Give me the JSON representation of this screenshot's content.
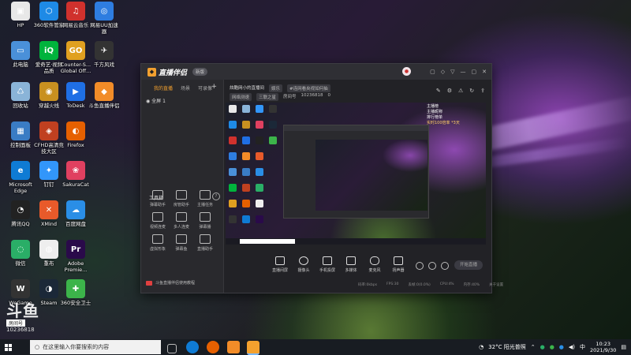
{
  "desktop": {
    "icons": [
      {
        "label": "HP",
        "color": "#e8e8e8",
        "glyph": "▣"
      },
      {
        "label": "360软件管家",
        "color": "#1e8ae6",
        "glyph": "⬡"
      },
      {
        "label": "网易云音乐",
        "color": "#d0312d",
        "glyph": "♫"
      },
      {
        "label": "网易UU加速器",
        "color": "#2e7de0",
        "glyph": "◎"
      },
      {
        "label": "此电脑",
        "color": "#4a90d9",
        "glyph": "▭"
      },
      {
        "label": "爱奇艺·视频\n品质",
        "color": "#00b33c",
        "glyph": "iQ"
      },
      {
        "label": "Counter-S...\nGlobal Off...",
        "color": "#e0a020",
        "glyph": "GO"
      },
      {
        "label": "千方风戏",
        "color": "#333333",
        "glyph": "✈"
      },
      {
        "label": "回收站",
        "color": "#8ab4d8",
        "glyph": "♺"
      },
      {
        "label": "穿越火线",
        "color": "#c89020",
        "glyph": "◉"
      },
      {
        "label": "ToDesk",
        "color": "#1f6fe5",
        "glyph": "▶"
      },
      {
        "label": "斗鱼直播伴侣",
        "color": "#f28c28",
        "glyph": "◆"
      },
      {
        "label": "控制面板",
        "color": "#3a7cc4",
        "glyph": "▦"
      },
      {
        "label": "CFHD高清竞\n技大区",
        "color": "#c04020",
        "glyph": "◈"
      },
      {
        "label": "Firefox",
        "color": "#e66000",
        "glyph": "◐"
      },
      {
        "label": "Microsoft\nEdge",
        "color": "#0f7bd4",
        "glyph": "e"
      },
      {
        "label": "钉钉",
        "color": "#3296fa",
        "glyph": "✦"
      },
      {
        "label": "SakuraCat",
        "color": "#e04060",
        "glyph": "❀"
      },
      {
        "label": "腾讯QQ",
        "color": "#222222",
        "glyph": "◔"
      },
      {
        "label": "XMind",
        "color": "#e85a2a",
        "glyph": "✕"
      },
      {
        "label": "百度网盘",
        "color": "#2a8ee6",
        "glyph": "☁"
      },
      {
        "label": "微信",
        "color": "#2aae67",
        "glyph": "◌"
      },
      {
        "label": "重布",
        "color": "#eeeeee",
        "glyph": "◍"
      },
      {
        "label": "Adobe\nPremie...",
        "color": "#2a0a4a",
        "glyph": "Pr"
      },
      {
        "label": "WeGame",
        "color": "#333333",
        "glyph": "W"
      },
      {
        "label": "Steam",
        "color": "#1b2838",
        "glyph": "◑"
      },
      {
        "label": "360安全卫士",
        "color": "#3cb44a",
        "glyph": "✚"
      }
    ]
  },
  "window": {
    "app_name": "直播伴侣",
    "version_badge": "新版",
    "avatar_glyph": "●",
    "titlebar_icons": [
      "chat-icon",
      "share-icon",
      "skin-icon",
      "minimize-icon",
      "maximize-icon",
      "close-icon"
    ],
    "titlebar_glyphs": [
      "▢",
      "◇",
      "▽",
      "—",
      "▢",
      "✕"
    ],
    "left_tabs": [
      "我的直播",
      "场景",
      "可录像"
    ],
    "add_glyph": "+",
    "scene_label": "全屏 1",
    "tools_title": "工具箱",
    "tools_help": "?",
    "tools": [
      {
        "label": "弹幕助手"
      },
      {
        "label": "房管助手"
      },
      {
        "label": "主播任务"
      },
      {
        "label": "视频连麦"
      },
      {
        "label": "多人连麦"
      },
      {
        "label": "弹幕播"
      },
      {
        "label": "虚拟形象"
      },
      {
        "label": "弹幕鱼"
      },
      {
        "label": "直播助手"
      }
    ],
    "left_footer": "斗鱼直播伴侣使用教程",
    "room_title": "炫酷网小的直播间",
    "room_tag": "娱乐",
    "room_chip": "#连网看央视如何抽",
    "row2_chip1": "网络测速",
    "row2_chip2": "三联之星",
    "room_id_label": "房间号",
    "room_id": "10236818",
    "follower_count": "0",
    "right_icons": [
      "edit-icon",
      "settings-icon",
      "alert-icon",
      "refresh-icon",
      "share-icon"
    ],
    "right_glyphs": [
      "✎",
      "⚙",
      "⚠",
      "↻",
      "⇪"
    ],
    "preview_overlay": [
      "主播榜",
      "主播昵称",
      "排行榜单",
      "实时100倍率 *3天"
    ],
    "controls": [
      {
        "label": "直播间屏",
        "name": "screen-capture"
      },
      {
        "label": "摄像头",
        "name": "camera"
      },
      {
        "label": "手机投屏",
        "name": "phone-cast"
      },
      {
        "label": "多媒体",
        "name": "media"
      },
      {
        "label": "麦克风",
        "name": "microphone"
      },
      {
        "label": "扬声器",
        "name": "speaker"
      }
    ],
    "go_live": "开始直播",
    "status": [
      "码率:0kbps",
      "FPS:30",
      "丢帧:0(0.0%)",
      "CPU:4%",
      "内存:40%",
      "关于设置"
    ]
  },
  "watermark": {
    "logo": "斗鱼",
    "sub": "房间号",
    "num": "10236818"
  },
  "taskbar": {
    "search_placeholder": "在这里输入你要搜索的内容",
    "weather": "32°C 阳光普照",
    "time": "10:23",
    "date": "2021/9/30"
  },
  "colors": {
    "accent": "#f4a12e",
    "window_bg": "#2a2a2e",
    "taskbar": "#181c22"
  }
}
